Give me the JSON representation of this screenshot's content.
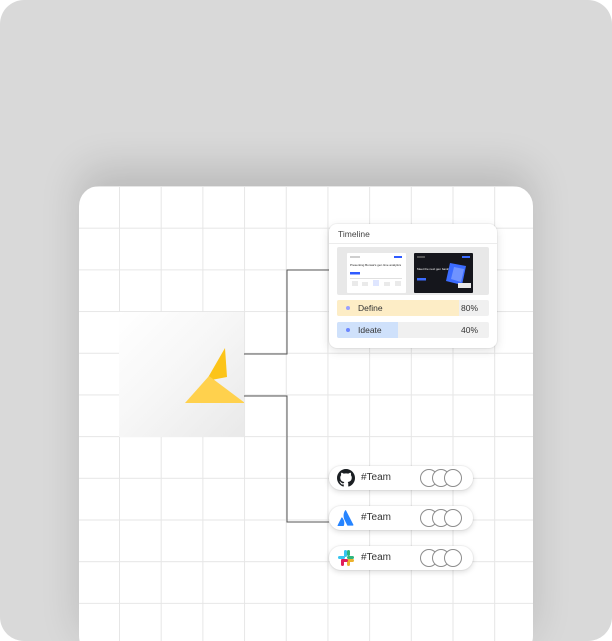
{
  "timeline": {
    "title": "Timeline",
    "previews": [
      {
        "name": "preview-light",
        "headline": "Presenting Bonsai's gen lime analytics"
      },
      {
        "name": "preview-dark",
        "headline": "Meet the next gen banking"
      }
    ],
    "progress": [
      {
        "label": "Define",
        "percent_text": "80%",
        "value": 0.8,
        "fill_color": "#fdedc6",
        "dot_color": "#9aa0ff"
      },
      {
        "label": "Ideate",
        "percent_text": "40%",
        "value": 0.4,
        "fill_color": "#cfe1fb",
        "dot_color": "#6b86ff"
      }
    ]
  },
  "teams": [
    {
      "icon": "github-icon",
      "label": "#Team"
    },
    {
      "icon": "atlassian-icon",
      "label": "#Team"
    },
    {
      "icon": "slack-icon",
      "label": "#Team"
    }
  ],
  "colors": {
    "background": "#d9d9d9",
    "board": "#ffffff",
    "grid": "#e6e6e6",
    "logo_yellow": "#fcc419",
    "logo_yellow_light": "#ffd14d",
    "atlassian_blue": "#2684ff",
    "connector": "#555555"
  }
}
